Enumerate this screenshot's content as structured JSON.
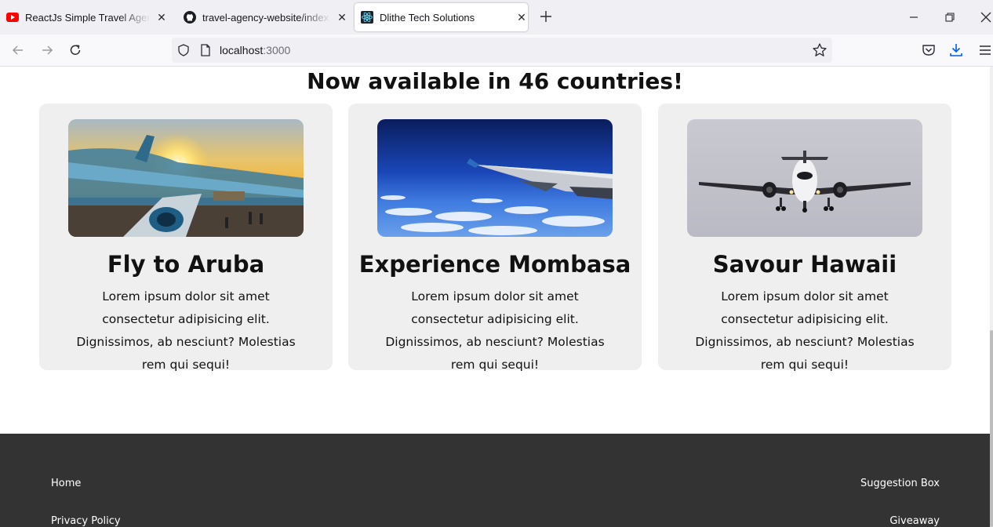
{
  "browser": {
    "tabs": [
      {
        "title": "ReactJs Simple Travel Agency La",
        "icon": "youtube-icon"
      },
      {
        "title": "travel-agency-website/index.css",
        "icon": "github-icon"
      },
      {
        "title": "Dlithe Tech Solutions",
        "icon": "react-icon",
        "active": true
      }
    ],
    "url_host": "localhost",
    "url_port": ":3000"
  },
  "page": {
    "headline": "Now available in 46 countries!",
    "cards": [
      {
        "title": "Fly to Aruba",
        "text": "Lorem ipsum dolor sit amet consectetur adipisicing elit. Dignissimos, ab nesciunt? Molestias rem qui sequi!",
        "image": "airplane-at-sunset-photo"
      },
      {
        "title": "Experience Mombasa",
        "text": "Lorem ipsum dolor sit amet consectetur adipisicing elit. Dignissimos, ab nesciunt? Molestias rem qui sequi!",
        "image": "airplane-wing-above-clouds-photo"
      },
      {
        "title": "Savour Hawaii",
        "text": "Lorem ipsum dolor sit amet consectetur adipisicing elit. Dignissimos, ab nesciunt? Molestias rem qui sequi!",
        "image": "airplane-front-view-photo"
      }
    ]
  },
  "footer": {
    "links_left": [
      "Home",
      "Privacy Policy"
    ],
    "links_right": [
      "Suggestion Box",
      "Giveaway"
    ]
  },
  "colors": {
    "footer_bg": "#333333",
    "card_bg": "#efefef"
  }
}
